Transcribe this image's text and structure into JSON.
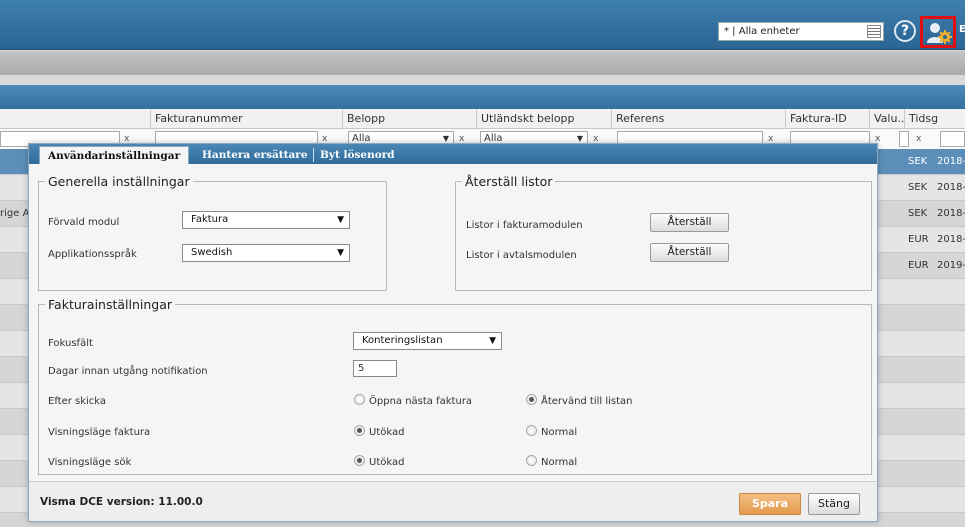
{
  "topbar": {
    "unit_select": "* | Alla enheter",
    "help_symbol": "?",
    "user_initial": "E",
    "icons": [
      "list-icon",
      "help-icon",
      "user-settings-icon"
    ],
    "highlight_color": "#e01010"
  },
  "grid": {
    "columns": [
      "Fakturanummer",
      "Belopp",
      "Utländskt belopp",
      "Referens",
      "Faktura-ID",
      "Valu...",
      "Tidsg"
    ],
    "filters": {
      "belopp": "Alla",
      "utlandskt": "Alla",
      "clear": "x"
    },
    "rows": [
      {
        "left": "",
        "currency": "SEK",
        "date": "2018-"
      },
      {
        "left": "",
        "currency": "SEK",
        "date": "2018-"
      },
      {
        "left": "rige Al",
        "currency": "SEK",
        "date": "2018-"
      },
      {
        "left": "",
        "currency": "EUR",
        "date": "2018-"
      },
      {
        "left": "",
        "currency": "EUR",
        "date": "2019-"
      }
    ]
  },
  "dialog": {
    "tabs": [
      "Användarinställningar",
      "Hantera ersättare",
      "Byt lösenord"
    ],
    "general": {
      "legend": "Generella inställningar",
      "default_module_label": "Förvald modul",
      "default_module_value": "Faktura",
      "language_label": "Applikationsspråk",
      "language_value": "Swedish"
    },
    "reset": {
      "legend": "Återställ listor",
      "invoice_lists_label": "Listor i fakturamodulen",
      "contract_lists_label": "Listor i avtalsmodulen",
      "reset_button": "Återställ"
    },
    "invoice": {
      "legend": "Fakturainställningar",
      "focus_label": "Fokusfält",
      "focus_value": "Konteringslistan",
      "days_label": "Dagar innan utgång notifikation",
      "days_value": "5",
      "after_send_label": "Efter skicka",
      "after_send_opt1": "Öppna nästa faktura",
      "after_send_opt2": "Återvänd till listan",
      "after_send_selected": 2,
      "view_invoice_label": "Visningsläge faktura",
      "view_search_label": "Visningsläge sök",
      "opt_extended": "Utökad",
      "opt_normal": "Normal",
      "view_invoice_selected": 1,
      "view_search_selected": 1
    },
    "footer": {
      "version": "Visma DCE version: 11.00.0",
      "save": "Spara",
      "close": "Stäng"
    },
    "colors": {
      "accent": "#2f6c9b",
      "save": "#e49a4a"
    }
  }
}
